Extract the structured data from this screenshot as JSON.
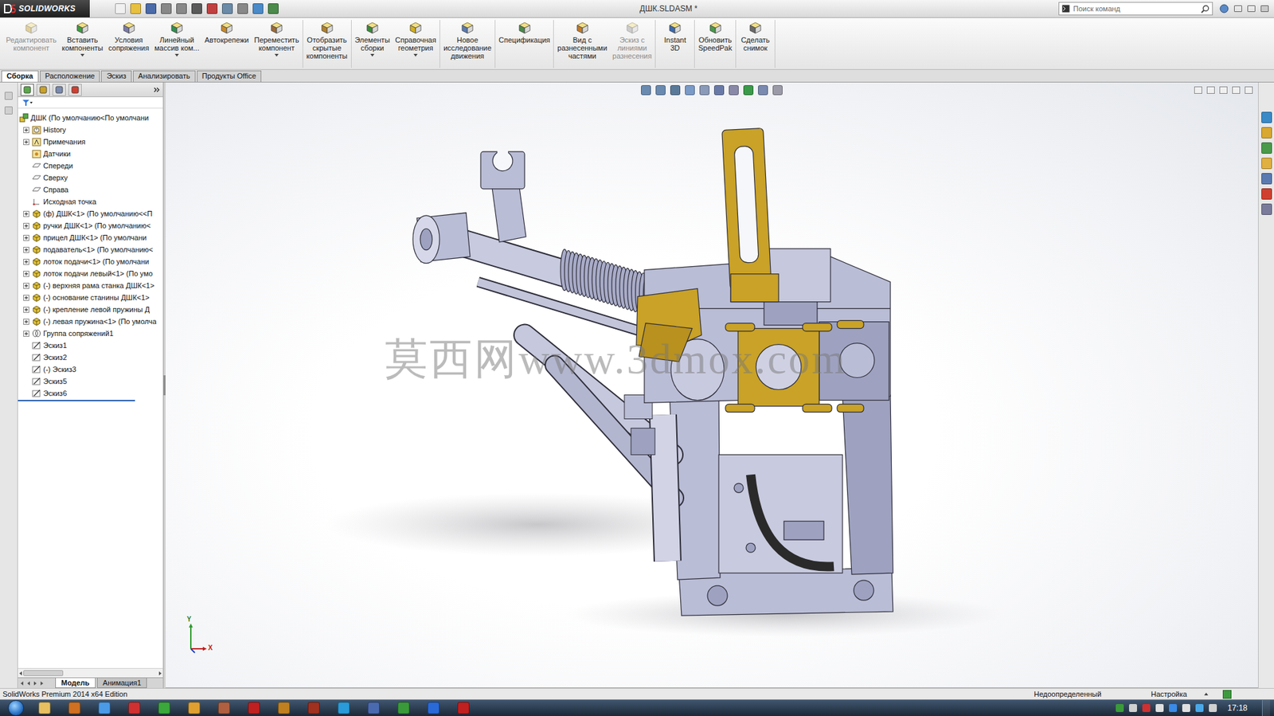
{
  "app": {
    "logo": "SOLIDWORKS",
    "title": "ДШК.SLDASM *",
    "search_placeholder": "Поиск команд"
  },
  "ribbon": [
    [
      {
        "lines": [
          "Редактировать",
          "компонент"
        ],
        "disabled": true,
        "dropdown": false
      },
      {
        "lines": [
          "Вставить",
          "компоненты"
        ],
        "disabled": false,
        "dropdown": true
      },
      {
        "lines": [
          "Условия",
          "сопряжения"
        ],
        "disabled": false,
        "dropdown": false
      },
      {
        "lines": [
          "Линейный",
          "массив ком..."
        ],
        "disabled": false,
        "dropdown": true
      },
      {
        "lines": [
          "Автокрепежи"
        ],
        "disabled": false,
        "dropdown": false
      },
      {
        "lines": [
          "Переместить",
          "компонент"
        ],
        "disabled": false,
        "dropdown": true
      }
    ],
    [
      {
        "lines": [
          "Отобразить",
          "скрытые",
          "компоненты"
        ],
        "disabled": false,
        "dropdown": false
      }
    ],
    [
      {
        "lines": [
          "Элементы",
          "сборки"
        ],
        "disabled": false,
        "dropdown": true
      },
      {
        "lines": [
          "Справочная",
          "геометрия"
        ],
        "disabled": false,
        "dropdown": true
      }
    ],
    [
      {
        "lines": [
          "Новое",
          "исследование",
          "движения"
        ],
        "disabled": false,
        "dropdown": false
      }
    ],
    [
      {
        "lines": [
          "Спецификация"
        ],
        "disabled": false,
        "dropdown": false
      }
    ],
    [
      {
        "lines": [
          "Вид с",
          "разнесенными",
          "частями"
        ],
        "disabled": false,
        "dropdown": false
      },
      {
        "lines": [
          "Эскиз с",
          "линиями",
          "разнесения"
        ],
        "disabled": true,
        "dropdown": false
      }
    ],
    [
      {
        "lines": [
          "Instant",
          "3D"
        ],
        "disabled": false,
        "dropdown": false
      }
    ],
    [
      {
        "lines": [
          "Обновить",
          "SpeedPak"
        ],
        "disabled": false,
        "dropdown": false
      }
    ],
    [
      {
        "lines": [
          "Сделать",
          "снимок"
        ],
        "disabled": false,
        "dropdown": false
      }
    ]
  ],
  "tabs": [
    {
      "label": "Сборка",
      "selected": true
    },
    {
      "label": "Расположение",
      "selected": false
    },
    {
      "label": "Эскиз",
      "selected": false
    },
    {
      "label": "Анализировать",
      "selected": false
    },
    {
      "label": "Продукты Office",
      "selected": false
    }
  ],
  "tree": {
    "items": [
      {
        "label": "ДШК  (По умолчанию<По умолчани",
        "kind": "assembly",
        "level": 0,
        "expandable": false,
        "expanded": true
      },
      {
        "label": "History",
        "kind": "history",
        "level": 1,
        "expandable": true,
        "expanded": false
      },
      {
        "label": "Примечания",
        "kind": "notes",
        "level": 1,
        "expandable": true,
        "expanded": false
      },
      {
        "label": "Датчики",
        "kind": "sensors",
        "level": 1,
        "expandable": false,
        "expanded": false
      },
      {
        "label": "Спереди",
        "kind": "plane",
        "level": 1,
        "expandable": false,
        "expanded": false
      },
      {
        "label": "Сверху",
        "kind": "plane",
        "level": 1,
        "expandable": false,
        "expanded": false
      },
      {
        "label": "Справа",
        "kind": "plane",
        "level": 1,
        "expandable": false,
        "expanded": false
      },
      {
        "label": "Исходная точка",
        "kind": "origin",
        "level": 1,
        "expandable": false,
        "expanded": false
      },
      {
        "label": "(ф) ДШК<1> (По умолчанию<<П",
        "kind": "part",
        "level": 1,
        "expandable": true,
        "expanded": false
      },
      {
        "label": "ручки ДШК<1> (По умолчанию<",
        "kind": "part",
        "level": 1,
        "expandable": true,
        "expanded": false
      },
      {
        "label": "прицел ДШК<1> (По умолчани",
        "kind": "part",
        "level": 1,
        "expandable": true,
        "expanded": false
      },
      {
        "label": "подаватель<1> (По умолчанию<",
        "kind": "part",
        "level": 1,
        "expandable": true,
        "expanded": false
      },
      {
        "label": "лоток подачи<1> (По умолчани",
        "kind": "part",
        "level": 1,
        "expandable": true,
        "expanded": false
      },
      {
        "label": "лоток подачи левый<1> (По умо",
        "kind": "part",
        "level": 1,
        "expandable": true,
        "expanded": false
      },
      {
        "label": "(-) верхняя рама станка ДШК<1>",
        "kind": "part",
        "level": 1,
        "expandable": true,
        "expanded": false
      },
      {
        "label": "(-) основание станины ДШК<1>",
        "kind": "part",
        "level": 1,
        "expandable": true,
        "expanded": false
      },
      {
        "label": "(-) крепление левой пружины Д",
        "kind": "part",
        "level": 1,
        "expandable": true,
        "expanded": false
      },
      {
        "label": "(-) левая пружина<1> (По умолча",
        "kind": "part",
        "level": 1,
        "expandable": true,
        "expanded": false
      },
      {
        "label": "Группа сопряжений1",
        "kind": "mates",
        "level": 1,
        "expandable": true,
        "expanded": false
      },
      {
        "label": "Эскиз1",
        "kind": "sketch",
        "level": 1,
        "expandable": false,
        "expanded": false
      },
      {
        "label": "Эскиз2",
        "kind": "sketch",
        "level": 1,
        "expandable": false,
        "expanded": false
      },
      {
        "label": "(-) Эскиз3",
        "kind": "sketch",
        "level": 1,
        "expandable": false,
        "expanded": false
      },
      {
        "label": "Эскиз5",
        "kind": "sketch",
        "level": 1,
        "expandable": false,
        "expanded": false
      },
      {
        "label": "Эскиз6",
        "kind": "sketch",
        "level": 1,
        "expandable": false,
        "expanded": false
      }
    ]
  },
  "model_tabs": [
    {
      "label": "Модель",
      "selected": true
    },
    {
      "label": "Анимация1",
      "selected": false
    }
  ],
  "viewport": {
    "watermark": "莫西网www.3dmox.com",
    "triad": {
      "y": "Y",
      "x": "X"
    }
  },
  "status_bar": {
    "edition": "SolidWorks Premium 2014 x64 Edition",
    "state": "Недоопределенный",
    "mode": "Настройка"
  },
  "taskbar": {
    "time": "17:18"
  }
}
